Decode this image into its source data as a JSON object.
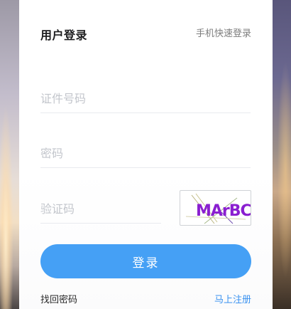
{
  "login": {
    "title": "用户登录",
    "quick_login_label": "手机快速登录",
    "id_placeholder": "证件号码",
    "password_placeholder": "密码",
    "captcha_placeholder": "验证码",
    "captcha_text": "MArBC",
    "login_button_label": "登录",
    "forgot_password_label": "找回密码",
    "register_label": "马上注册"
  },
  "colors": {
    "accent": "#45a0f5",
    "link": "#3a92f0",
    "captcha_text": "#8a1fd0"
  }
}
